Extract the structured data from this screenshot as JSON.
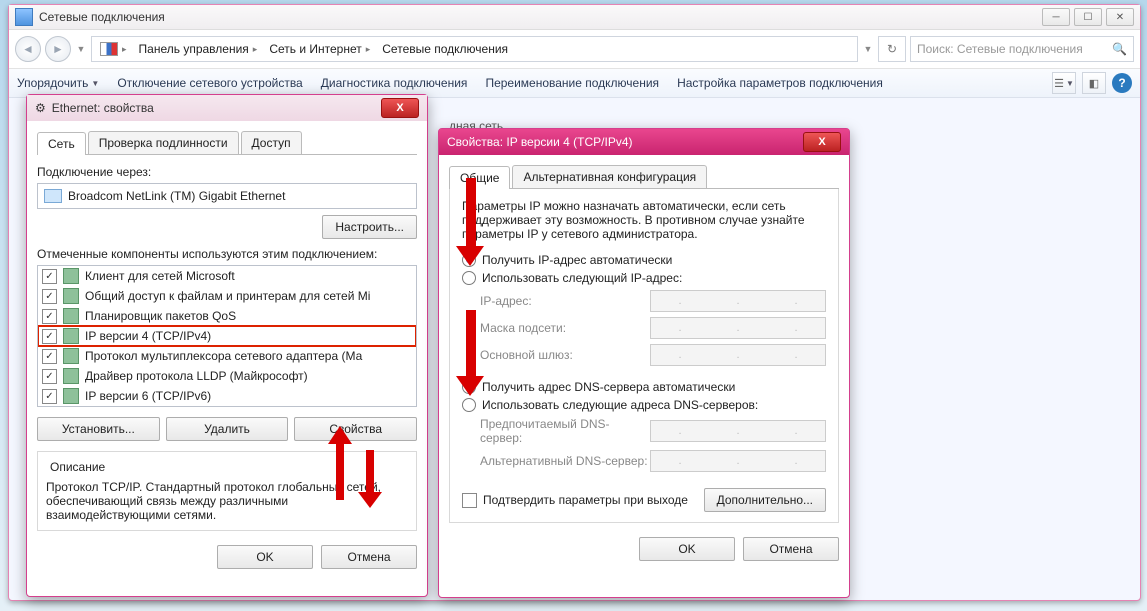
{
  "mainWindow": {
    "title": "Сетевые подключения",
    "searchPlaceholder": "Поиск: Сетевые подключения",
    "breadcrumb": [
      "Панель управления",
      "Сеть и Интернет",
      "Сетевые подключения"
    ],
    "toolbar": {
      "organize": "Упорядочить",
      "disable": "Отключение сетевого устройства",
      "diagnose": "Диагностика подключения",
      "rename": "Переименование подключения",
      "settings": "Настройка параметров подключения"
    },
    "bgHint": "дная сеть"
  },
  "ethDialog": {
    "title": "Ethernet: свойства",
    "tabs": {
      "net": "Сеть",
      "auth": "Проверка подлинности",
      "access": "Доступ"
    },
    "connectVia": "Подключение через:",
    "adapter": "Broadcom NetLink (TM) Gigabit Ethernet",
    "configureBtn": "Настроить...",
    "componentsLabel": "Отмеченные компоненты используются этим подключением:",
    "components": [
      "Клиент для сетей Microsoft",
      "Общий доступ к файлам и принтерам для сетей Mi",
      "Планировщик пакетов QoS",
      "IP версии 4 (TCP/IPv4)",
      "Протокол мультиплексора сетевого адаптера (Ма",
      "Драйвер протокола LLDP (Майкрософт)",
      "IP версии 6 (TCP/IPv6)"
    ],
    "installBtn": "Установить...",
    "removeBtn": "Удалить",
    "propsBtn": "Свойства",
    "descTitle": "Описание",
    "descText": "Протокол TCP/IP. Стандартный протокол глобальных сетей, обеспечивающий связь между различными взаимодействующими сетями.",
    "ok": "OK",
    "cancel": "Отмена"
  },
  "ipv4Dialog": {
    "title": "Свойства: IP версии 4 (TCP/IPv4)",
    "tabs": {
      "general": "Общие",
      "alt": "Альтернативная конфигурация"
    },
    "intro": "Параметры IP можно назначать автоматически, если сеть поддерживает эту возможность. В противном случае узнайте параметры IP у сетевого администратора.",
    "autoIp": "Получить IP-адрес автоматически",
    "manualIp": "Использовать следующий IP-адрес:",
    "ipLabel": "IP-адрес:",
    "maskLabel": "Маска подсети:",
    "gwLabel": "Основной шлюз:",
    "autoDns": "Получить адрес DNS-сервера автоматически",
    "manualDns": "Использовать следующие адреса DNS-серверов:",
    "dns1": "Предпочитаемый DNS-сервер:",
    "dns2": "Альтернативный DNS-сервер:",
    "confirmExit": "Подтвердить параметры при выходе",
    "advanced": "Дополнительно...",
    "ok": "OK",
    "cancel": "Отмена"
  }
}
